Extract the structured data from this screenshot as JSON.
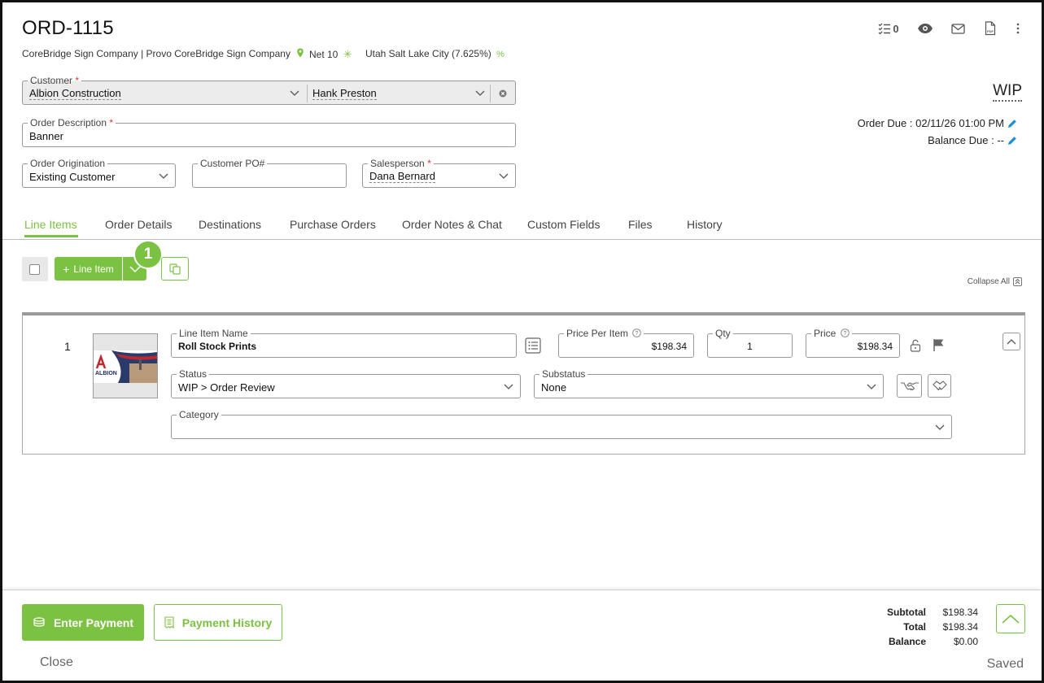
{
  "header": {
    "order_number": "ORD-1115",
    "company": "CoreBridge Sign Company | Provo CoreBridge Sign Company",
    "terms": "Net 10",
    "tax": "Utah Salt Lake City (7.625%)",
    "task_count": "0",
    "status": "WIP",
    "order_due_label": "Order Due : 02/11/26 01:00 PM",
    "balance_due_label": "Balance Due : --"
  },
  "form": {
    "customer_label": "Customer",
    "customer_value": "Albion Construction",
    "contact_value": "Hank Preston",
    "description_label": "Order Description",
    "description_value": "Banner",
    "origination_label": "Order Origination",
    "origination_value": "Existing Customer",
    "po_label": "Customer PO#",
    "po_value": "",
    "salesperson_label": "Salesperson",
    "salesperson_value": "Dana Bernard"
  },
  "tabs": [
    "Line Items",
    "Order Details",
    "Destinations",
    "Purchase Orders",
    "Order Notes & Chat",
    "Custom Fields",
    "Files",
    "History"
  ],
  "toolbar": {
    "add_line_item": "Line Item",
    "step_badge": "1",
    "collapse_all": "Collapse All"
  },
  "line_item": {
    "number": "1",
    "thumbnail_text": "ALBION",
    "name_label": "Line Item Name",
    "name_value": "Roll Stock Prints",
    "price_per_item_label": "Price Per Item",
    "price_per_item_value": "$198.34",
    "qty_label": "Qty",
    "qty_value": "1",
    "price_label": "Price",
    "price_value": "$198.34",
    "status_label": "Status",
    "status_value": "WIP > Order Review",
    "substatus_label": "Substatus",
    "substatus_value": "None",
    "category_label": "Category",
    "category_value": ""
  },
  "footer": {
    "enter_payment": "Enter Payment",
    "payment_history": "Payment History",
    "close": "Close",
    "saved": "Saved",
    "subtotal_label": "Subtotal",
    "subtotal_value": "$198.34",
    "total_label": "Total",
    "total_value": "$198.34",
    "balance_label": "Balance",
    "balance_value": "$0.00"
  },
  "colors": {
    "accent": "#7cc242",
    "required": "#dd3333",
    "edit_icon": "#1a8fd6"
  },
  "icons": [
    "tasks-icon",
    "eye-icon",
    "mail-icon",
    "pdf-icon",
    "more-vertical-icon",
    "location-pin-icon",
    "asterisk-icon",
    "percent-icon",
    "clear-icon",
    "pencil-icon",
    "plus-icon",
    "chevron-down-icon",
    "copy-icon",
    "collapse-icon",
    "list-icon",
    "help-icon",
    "unlock-icon",
    "flag-icon",
    "handshake-icon",
    "handshake-alt-icon",
    "chevron-up-icon",
    "cash-icon",
    "receipt-icon"
  ]
}
